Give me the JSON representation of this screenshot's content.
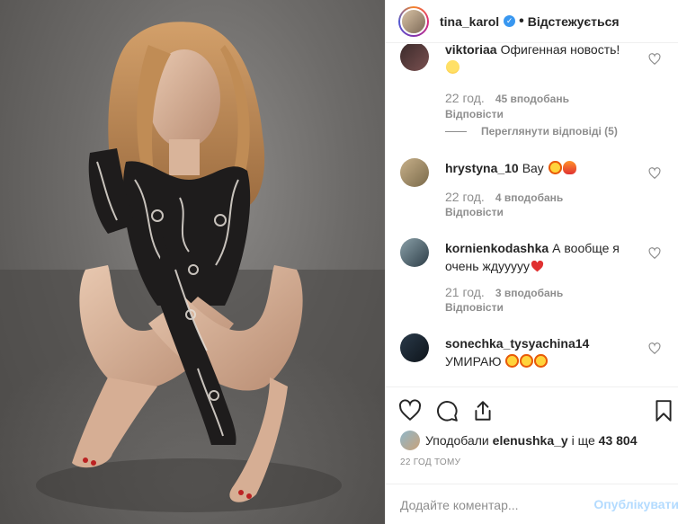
{
  "post": {
    "username": "tina_karol",
    "follow_state": "Відстежується",
    "verified": true
  },
  "comments": [
    {
      "user": "viktoriaa",
      "text": "Офигенная новость!",
      "emoji": [
        "smile"
      ],
      "time": "22 год.",
      "likes": "45 вподобань",
      "reply": "Відповісти",
      "view_replies": "Переглянути відповіді (5)"
    },
    {
      "user": "hrystyna_10",
      "text": "Вау",
      "emoji": [
        "star-struck",
        "fire"
      ],
      "time": "22 год.",
      "likes": "4 вподобань",
      "reply": "Відповісти"
    },
    {
      "user": "kornienkodashka",
      "text": "А вообще я очень ждууууу",
      "emoji": [
        "heart"
      ],
      "time": "21 год.",
      "likes": "3 вподобань",
      "reply": "Відповісти"
    },
    {
      "user": "sonechka_tysyachina14",
      "text": "УМИРАЮ",
      "emoji": [
        "star-struck",
        "star-struck",
        "star-struck"
      ]
    }
  ],
  "actions": {
    "like_icon": "heart-outline-icon",
    "comment_icon": "comment-bubble-icon",
    "share_icon": "share-icon",
    "save_icon": "bookmark-icon"
  },
  "likes_summary": {
    "prefix": "Уподобали",
    "user": "elenushka_y",
    "middle": "і ще",
    "count": "43 804"
  },
  "time_ago": "22 ГОД ТОМУ",
  "comment_input": {
    "placeholder": "Додайте коментар...",
    "post_label": "Опублікувати"
  },
  "colors": {
    "link_blue": "#3897f0",
    "post_disabled": "#b3dbff",
    "meta_gray": "#8e8e8e"
  }
}
